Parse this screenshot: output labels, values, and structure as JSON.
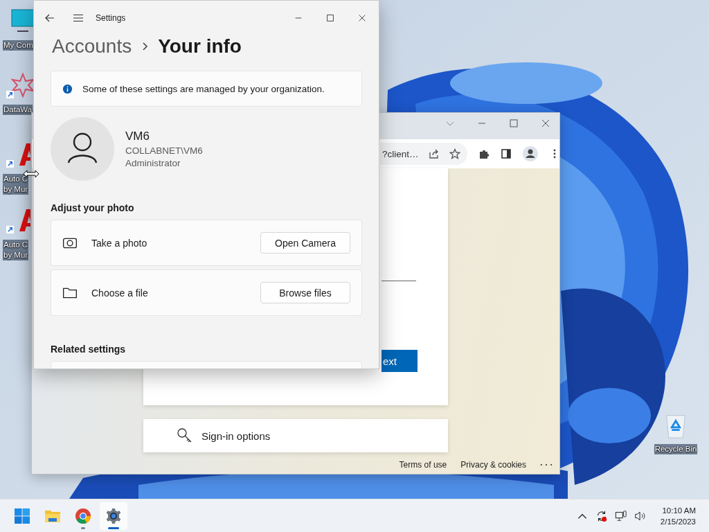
{
  "desktop": {
    "icons": [
      {
        "kind": "computer",
        "shortcut": false,
        "lines": [
          "My Com"
        ]
      },
      {
        "kind": "star",
        "shortcut": true,
        "lines": [
          "DataWa"
        ]
      },
      {
        "kind": "letter-a",
        "shortcut": true,
        "lines": [
          "Auto C",
          "by Mur"
        ]
      },
      {
        "kind": "letter-a",
        "shortcut": true,
        "lines": [
          "Auto C",
          "by Mur"
        ]
      }
    ],
    "recycle_bin": {
      "label": "Recycle Bin"
    }
  },
  "browser": {
    "address": "?client…",
    "next_button": "ext",
    "sign_in": "Sign-in options",
    "footer_links": [
      "Terms of use",
      "Privacy & cookies"
    ]
  },
  "settings": {
    "title": "Settings",
    "breadcrumb": [
      "Accounts",
      "Your info"
    ],
    "notice": "Some of these settings are managed by your organization.",
    "user": {
      "name": "VM6",
      "account": "COLLABNET\\VM6",
      "role": "Administrator"
    },
    "photo_heading": "Adjust your photo",
    "photo_options": [
      {
        "kind": "camera",
        "label": "Take a photo",
        "button": "Open Camera"
      },
      {
        "kind": "folder",
        "label": "Choose a file",
        "button": "Browse files"
      }
    ],
    "related_heading": "Related settings"
  },
  "taskbar": {
    "apps": [
      {
        "kind": "start",
        "running": false,
        "selected": false
      },
      {
        "kind": "explorer",
        "running": false,
        "selected": false
      },
      {
        "kind": "chrome",
        "running": true,
        "selected": false
      },
      {
        "kind": "settings",
        "running": true,
        "selected": true
      }
    ],
    "clock": {
      "time": "10:10 AM",
      "date": "2/15/2023"
    }
  }
}
